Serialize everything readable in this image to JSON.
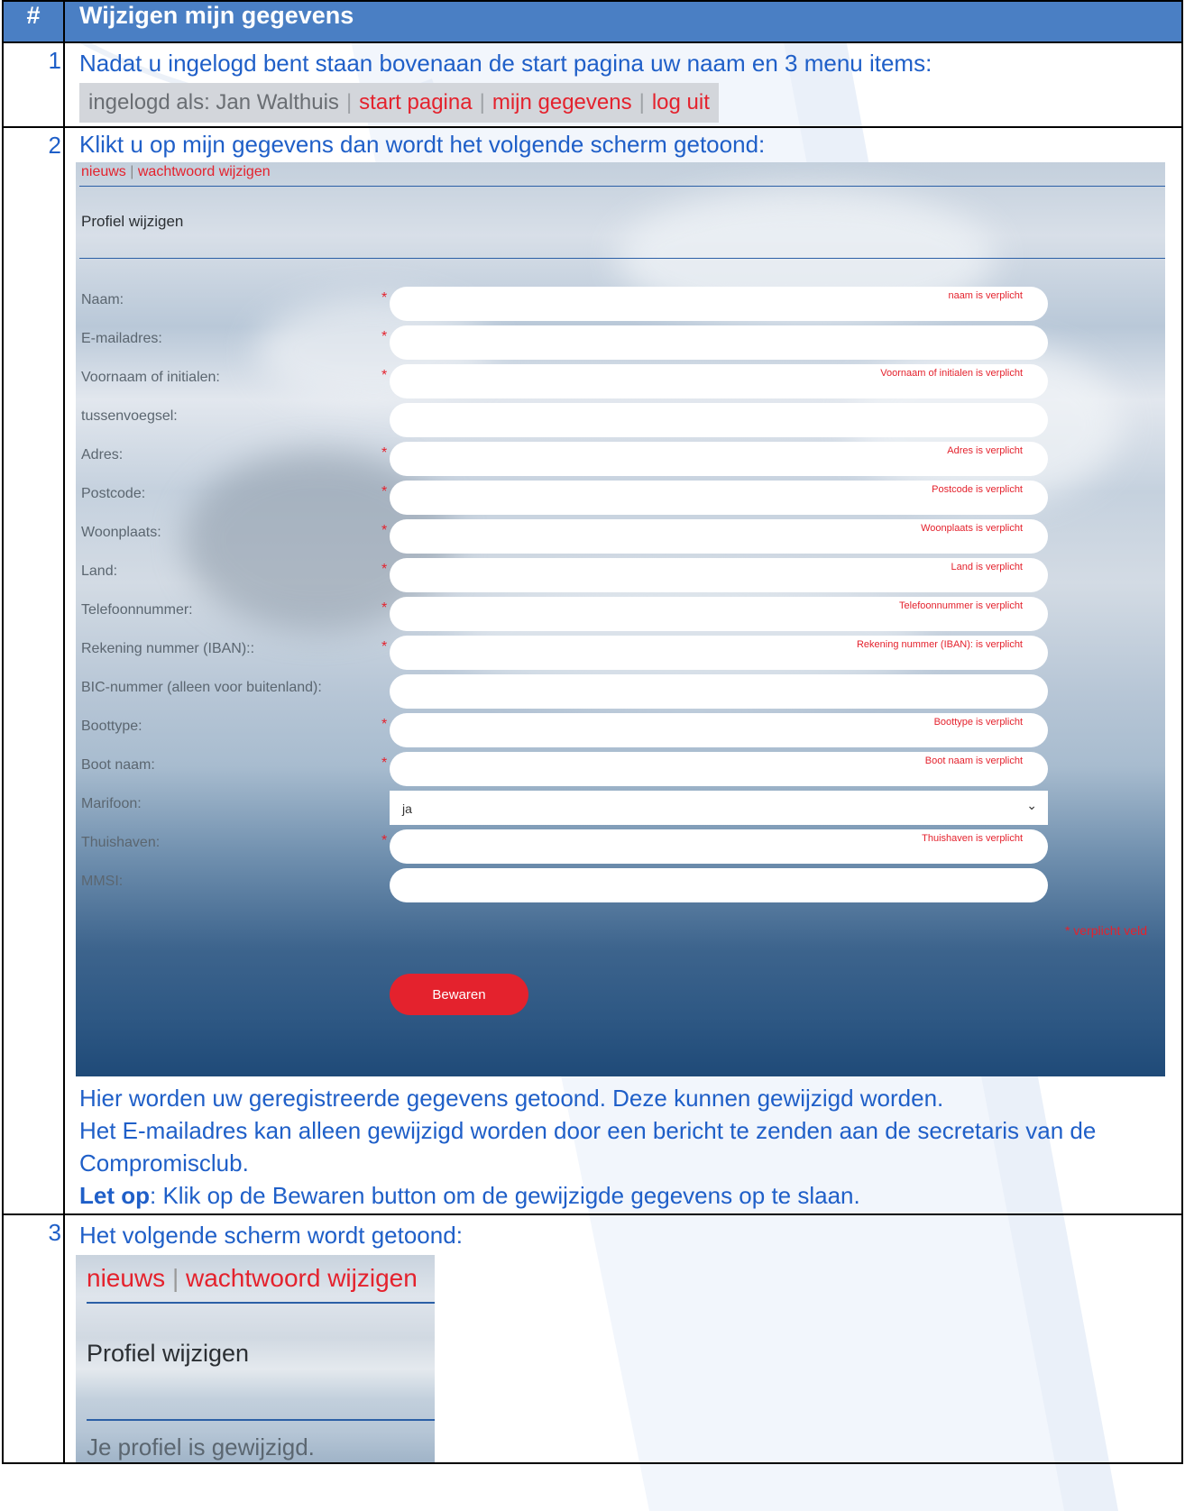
{
  "header": {
    "num": "#",
    "title": "Wijzigen mijn gegevens"
  },
  "step1": {
    "num": "1",
    "text": "Nadat u ingelogd bent staan bovenaan de start pagina uw naam en 3 menu items:",
    "bar": {
      "logged_in": "ingelogd als: Jan Walthuis",
      "sep": "|",
      "start": "start pagina",
      "profile": "mijn gegevens",
      "logout": "log uit"
    }
  },
  "step2": {
    "num": "2",
    "text": "Klikt u op mijn gegevens dan wordt het volgende scherm getoond:",
    "screen": {
      "link_news": "nieuws",
      "link_sep": "|",
      "link_password": "wachtwoord wijzigen",
      "title": "Profiel wijzigen",
      "fields": [
        {
          "label": "Naam:",
          "star": "*",
          "error": "naam is verplicht"
        },
        {
          "label": "E-mailadres:",
          "star": "*",
          "error": ""
        },
        {
          "label": "Voornaam of initialen:",
          "star": "*",
          "error": "Voornaam of initialen is verplicht"
        },
        {
          "label": "tussenvoegsel:",
          "star": "",
          "error": ""
        },
        {
          "label": "Adres:",
          "star": "*",
          "error": "Adres is verplicht"
        },
        {
          "label": "Postcode:",
          "star": "*",
          "error": "Postcode is verplicht"
        },
        {
          "label": "Woonplaats:",
          "star": "*",
          "error": "Woonplaats is verplicht"
        },
        {
          "label": "Land:",
          "star": "*",
          "error": "Land is verplicht"
        },
        {
          "label": "Telefoonnummer:",
          "star": "*",
          "error": "Telefoonnummer is verplicht"
        },
        {
          "label": "Rekening nummer (IBAN)::",
          "star": "*",
          "error": "Rekening nummer (IBAN): is verplicht"
        },
        {
          "label": "BIC-nummer (alleen voor buitenland):",
          "star": "",
          "error": ""
        },
        {
          "label": "Boottype:",
          "star": "*",
          "error": "Boottype is verplicht"
        },
        {
          "label": "Boot naam:",
          "star": "*",
          "error": "Boot naam is verplicht"
        },
        {
          "label": "Marifoon:",
          "select": "ja"
        },
        {
          "label": "Thuishaven:",
          "star": "*",
          "error": "Thuishaven is verplicht"
        },
        {
          "label": "MMSI:",
          "star": "",
          "error": ""
        }
      ],
      "required_note": "* verplicht veld",
      "save_button": "Bewaren"
    },
    "note1": "Hier worden uw geregistreerde gegevens getoond. Deze kunnen gewijzigd worden.",
    "note2": "Het E-mailadres kan alleen gewijzigd worden door een bericht te zenden aan de secretaris van de Compromisclub.",
    "note3_bold": "Let op",
    "note3_rest": ": Klik op de Bewaren button om de gewijzigde gegevens op te slaan."
  },
  "step3": {
    "num": "3",
    "text": "Het volgende scherm wordt getoond:",
    "screen": {
      "link_news": "nieuws",
      "link_sep": "|",
      "link_password": "wachtwoord wijzigen",
      "title": "Profiel wijzigen",
      "message": "Je profiel is gewijzigd."
    }
  }
}
